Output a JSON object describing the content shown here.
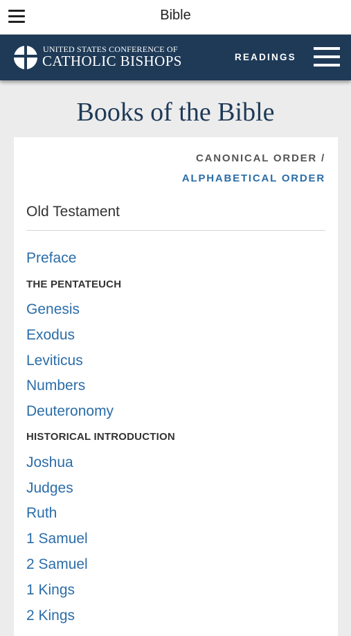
{
  "app_bar": {
    "title": "Bible"
  },
  "site_header": {
    "logo_line1": "UNITED STATES CONFERENCE OF",
    "logo_line2": "CATHOLIC BISHOPS",
    "readings_label": "READINGS"
  },
  "page": {
    "title": "Books of the Bible",
    "order_canonical": "CANONICAL ORDER /",
    "order_alphabetical": "ALPHABETICAL ORDER",
    "section": "Old Testament",
    "items": [
      {
        "type": "link",
        "label": "Preface"
      },
      {
        "type": "group",
        "label": "THE PENTATEUCH"
      },
      {
        "type": "link",
        "label": "Genesis"
      },
      {
        "type": "link",
        "label": "Exodus"
      },
      {
        "type": "link",
        "label": "Leviticus"
      },
      {
        "type": "link",
        "label": "Numbers"
      },
      {
        "type": "link",
        "label": "Deuteronomy"
      },
      {
        "type": "group",
        "label": "HISTORICAL INTRODUCTION"
      },
      {
        "type": "link",
        "label": "Joshua"
      },
      {
        "type": "link",
        "label": "Judges"
      },
      {
        "type": "link",
        "label": "Ruth"
      },
      {
        "type": "link",
        "label": "1 Samuel"
      },
      {
        "type": "link",
        "label": "2 Samuel"
      },
      {
        "type": "link",
        "label": "1 Kings"
      },
      {
        "type": "link",
        "label": "2 Kings"
      }
    ]
  },
  "colors": {
    "header_bg": "#1e3a57",
    "link": "#2b6da8",
    "title": "#1e3a57"
  }
}
